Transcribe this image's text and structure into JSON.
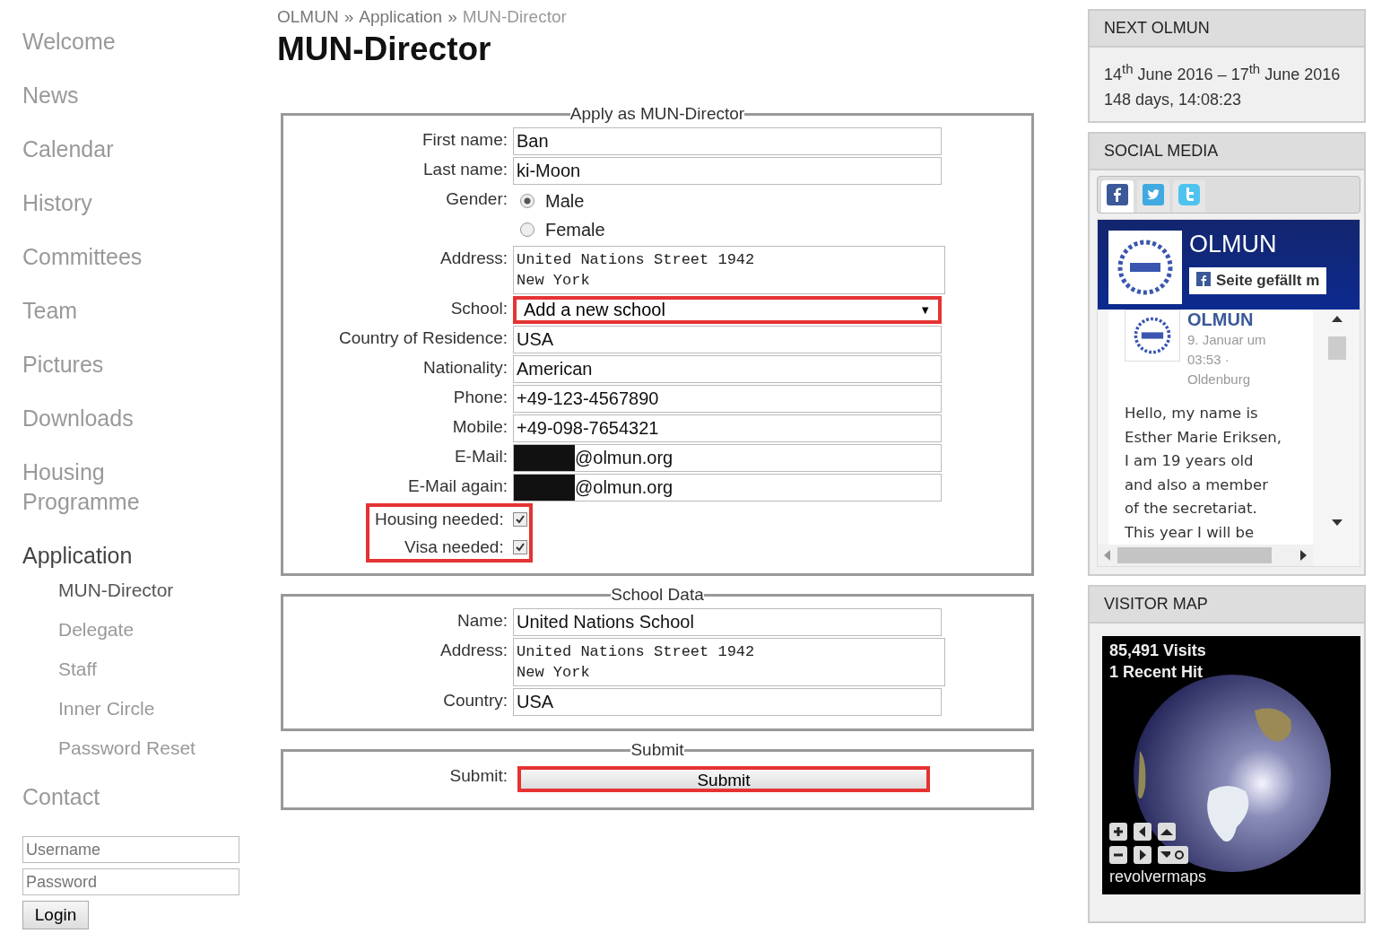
{
  "sidebar": {
    "items": [
      {
        "label": "Welcome",
        "selected": false
      },
      {
        "label": "News",
        "selected": false
      },
      {
        "label": "Calendar",
        "selected": false
      },
      {
        "label": "History",
        "selected": false
      },
      {
        "label": "Committees",
        "selected": false
      },
      {
        "label": "Team",
        "selected": false
      },
      {
        "label": "Pictures",
        "selected": false
      },
      {
        "label": "Downloads",
        "selected": false
      },
      {
        "label": "Housing Programme",
        "selected": false
      },
      {
        "label": "Application",
        "selected": true,
        "children": [
          {
            "label": "MUN-Director",
            "selected": true
          },
          {
            "label": "Delegate",
            "selected": false
          },
          {
            "label": "Staff",
            "selected": false
          },
          {
            "label": "Inner Circle",
            "selected": false
          },
          {
            "label": "Password Reset",
            "selected": false
          }
        ]
      },
      {
        "label": "Contact",
        "selected": false
      }
    ],
    "login": {
      "username_placeholder": "Username",
      "password_placeholder": "Password",
      "button": "Login"
    }
  },
  "breadcrumb": {
    "separator": "»",
    "items": [
      "OLMUN",
      "Application",
      "MUN-Director"
    ]
  },
  "title": "MUN-Director",
  "fieldsets": [
    {
      "legend": "Apply as MUN-Director",
      "rows": [
        {
          "kind": "text",
          "label": "First name:",
          "value": "Ban",
          "highlighted": false
        },
        {
          "kind": "text",
          "label": "Last name:",
          "value": "ki-Moon",
          "highlighted": false
        },
        {
          "kind": "radio",
          "label": "Gender:",
          "options": [
            {
              "label": "Male",
              "selected": true
            },
            {
              "label": "Female",
              "selected": false
            }
          ]
        },
        {
          "kind": "textarea",
          "label": "Address:",
          "lines": [
            "United Nations Street 1942",
            "New York"
          ]
        },
        {
          "kind": "select",
          "label": "School:",
          "value": "Add a new school",
          "arrow": "▼",
          "highlighted": true
        },
        {
          "kind": "text",
          "label": "Country of Residence:",
          "value": "USA",
          "highlighted": false
        },
        {
          "kind": "text",
          "label": "Nationality:",
          "value": "American",
          "highlighted": false
        },
        {
          "kind": "text",
          "label": "Phone:",
          "value": "+49-123-4567890",
          "highlighted": false
        },
        {
          "kind": "text",
          "label": "Mobile:",
          "value": "+49-098-7654321",
          "highlighted": false
        },
        {
          "kind": "redacted",
          "label": "E-Mail:",
          "value": "@olmun.org"
        },
        {
          "kind": "redacted",
          "label": "E-Mail again:",
          "value": "@olmun.org"
        },
        {
          "kind": "checks",
          "highlighted": true,
          "items": [
            {
              "label": "Housing needed:",
              "checked": true
            },
            {
              "label": "Visa needed:",
              "checked": true
            }
          ]
        }
      ]
    },
    {
      "legend": "School Data",
      "rows": [
        {
          "kind": "text",
          "label": "Name:",
          "value": "United Nations School",
          "highlighted": false
        },
        {
          "kind": "textarea",
          "label": "Address:",
          "lines": [
            "United Nations Street 1942",
            "New York"
          ]
        },
        {
          "kind": "text",
          "label": "Country:",
          "value": "USA",
          "highlighted": false
        }
      ]
    },
    {
      "legend": "Submit",
      "rows": [
        {
          "kind": "button",
          "label": "Submit:",
          "value": "Submit",
          "highlighted": true
        }
      ]
    }
  ],
  "right": {
    "next": {
      "title": "NEXT OLMUN",
      "dates": "14$^{th}$ June 2016  –  17$^{th}$ June 2016",
      "countdown": "148 days, 14:08:23"
    },
    "social": {
      "title": "SOCIAL MEDIA",
      "tabs": [
        {
          "kind": "facebook",
          "selected": true
        },
        {
          "kind": "twitter",
          "selected": false
        },
        {
          "kind": "twitter-alt",
          "selected": false
        }
      ],
      "page_name": "OLMUN",
      "like": "Seite gefällt m",
      "post_author": "OLMUN",
      "post_meta": "9. Januar um 03:53 · Oldenburg",
      "post_lines": [
        "Hello, my name is",
        "Esther Marie Eriksen,",
        "I am 19 years old",
        "and also a member",
        "of the secretariat.",
        "This year I will be"
      ]
    },
    "map": {
      "title": "VISITOR MAP",
      "visits": "85,491 Visits",
      "recent": "1 Recent Hit",
      "brand": "revolvermaps"
    }
  }
}
